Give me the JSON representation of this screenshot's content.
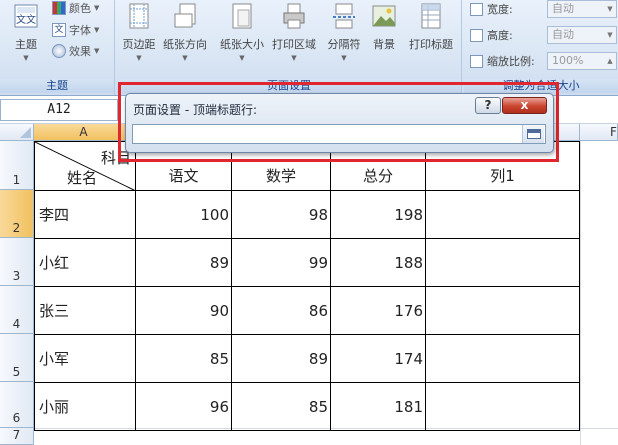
{
  "ribbon": {
    "theme_group": {
      "label": "主题",
      "themes_button": "主题",
      "colors": "颜色",
      "fonts": "字体",
      "effects": "效果"
    },
    "page_setup_group": {
      "label": "页面设置",
      "buttons": [
        "页边距",
        "纸张方向",
        "纸张大小",
        "打印区域",
        "分隔符",
        "背景",
        "打印标题"
      ]
    },
    "fit_group": {
      "label": "调整为合适大小",
      "width_label": "宽度:",
      "width_value": "自动",
      "height_label": "高度:",
      "height_value": "自动",
      "scale_label": "缩放比例:",
      "scale_value": "100%"
    }
  },
  "formula_bar": {
    "name_box": "A12"
  },
  "columns": {
    "a": "A",
    "f": "F"
  },
  "rows": [
    "1",
    "2",
    "3",
    "4",
    "5",
    "6",
    "7"
  ],
  "table": {
    "corner_top": "科目",
    "corner_bottom": "姓名",
    "headers": [
      "语文",
      "数学",
      "总分",
      "列1"
    ],
    "rows": [
      {
        "name": "李四",
        "values": [
          "100",
          "98",
          "198"
        ]
      },
      {
        "name": "小红",
        "values": [
          "89",
          "99",
          "188"
        ]
      },
      {
        "name": "张三",
        "values": [
          "90",
          "86",
          "176"
        ]
      },
      {
        "name": "小军",
        "values": [
          "85",
          "89",
          "174"
        ]
      },
      {
        "name": "小丽",
        "values": [
          "96",
          "85",
          "181"
        ]
      }
    ]
  },
  "dialog": {
    "title": "页面设置 - 顶端标题行:",
    "help": "?",
    "close": "x",
    "input_value": ""
  },
  "colors": {
    "highlight": "#e0262f",
    "selected_header": "#f1c15f"
  }
}
